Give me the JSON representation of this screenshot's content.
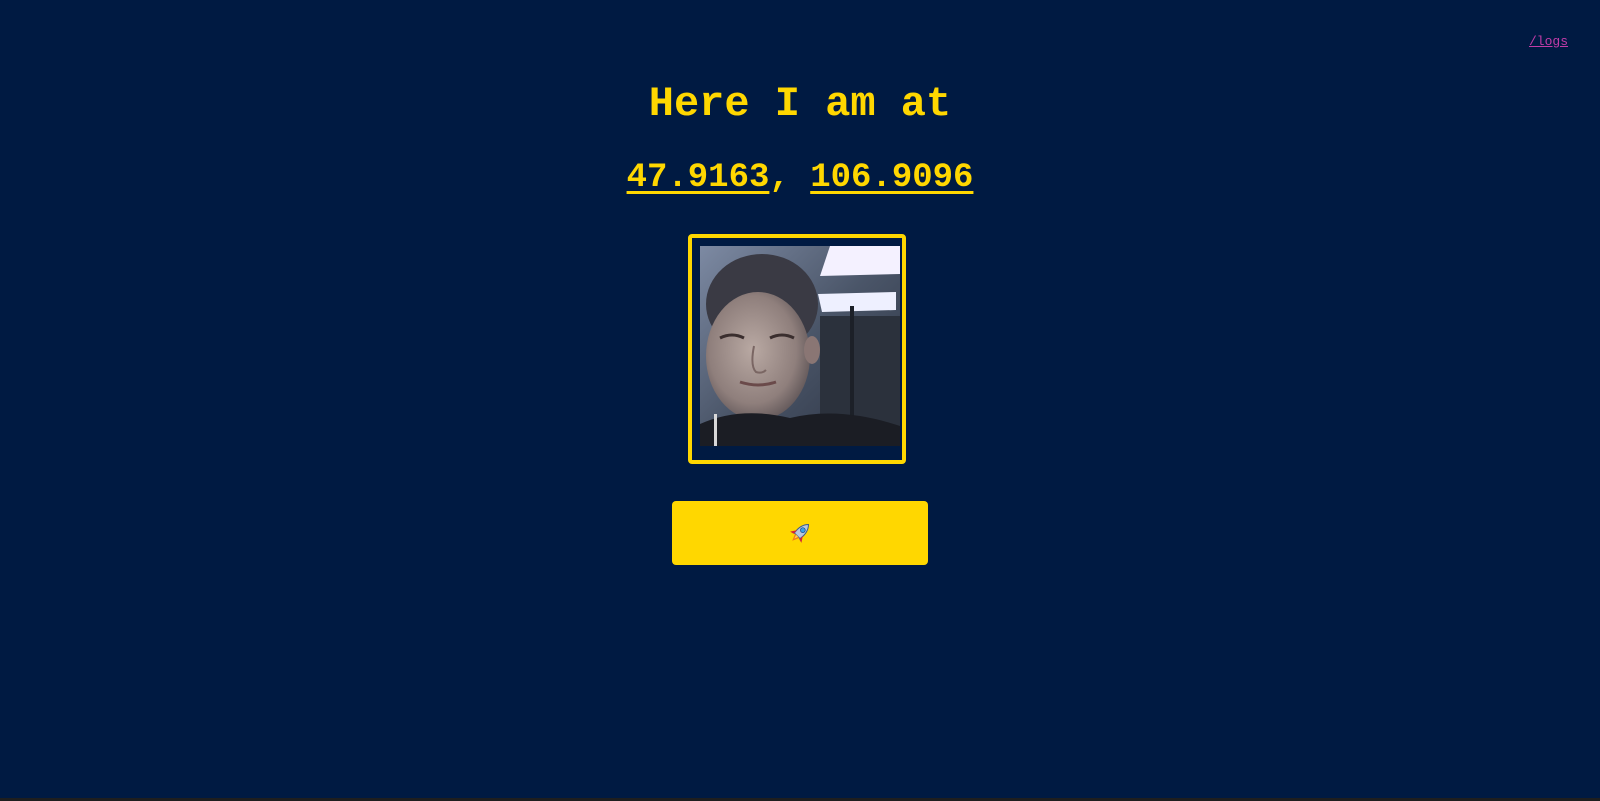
{
  "header": {
    "logs_link": "/logs",
    "title": "Here I am at"
  },
  "location": {
    "latitude": "47.9163",
    "separator": ",",
    "longitude": "106.9096"
  },
  "photo": {
    "description": "webcam snapshot"
  },
  "launch_button": {
    "icon": "rocket-icon"
  },
  "colors": {
    "background": "#001a42",
    "accent": "#ffd700",
    "link": "#c13ca8"
  }
}
